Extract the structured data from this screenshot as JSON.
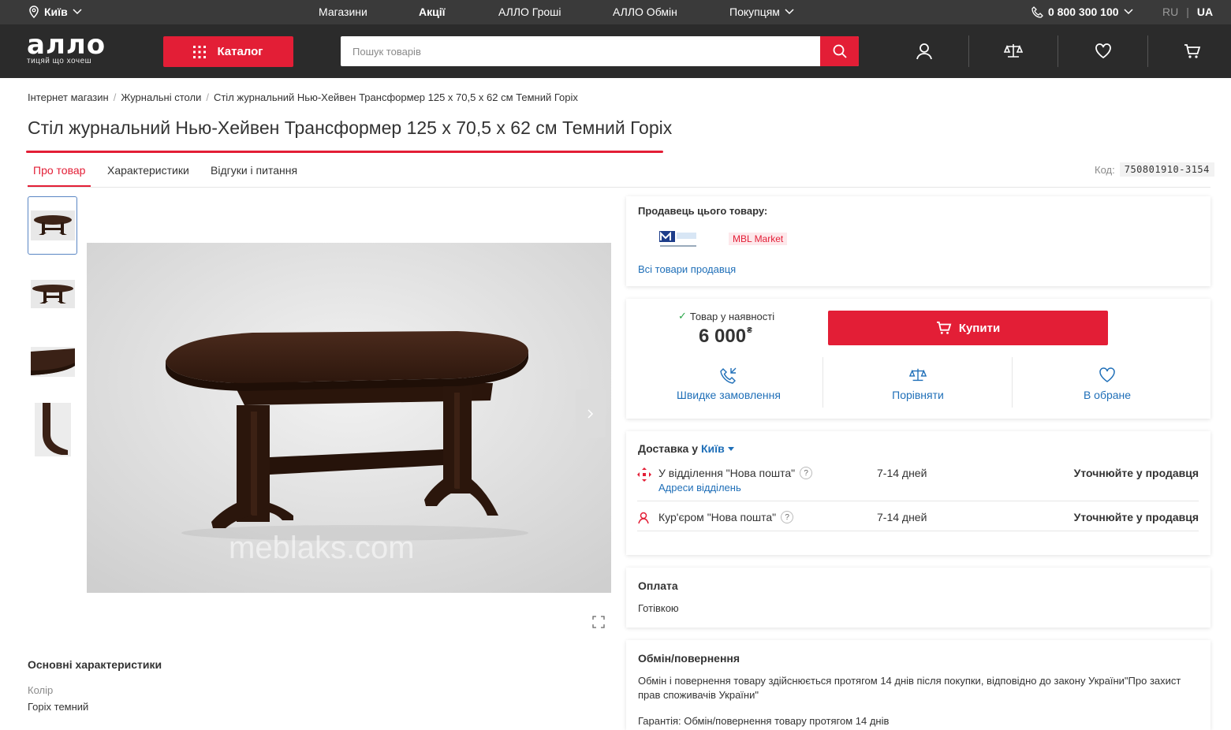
{
  "topbar": {
    "city": "Київ",
    "nav": [
      "Магазини",
      "Акції",
      "АЛЛО Гроші",
      "АЛЛО Обмін",
      "Покупцям"
    ],
    "phone": "0 800 300 100",
    "lang_ru": "RU",
    "lang_sep": "|",
    "lang_ua": "UA"
  },
  "header": {
    "logo": "алло",
    "slogan": "тицяй що хочеш",
    "catalog_label": "Каталог",
    "search_placeholder": "Пошук товарів"
  },
  "breadcrumb": [
    "Інтернет магазин",
    "Журнальні столи",
    "Стіл журнальний Нью-Хейвен Трансформер 125 x 70,5 x 62 см Темний Горіх"
  ],
  "breadcrumb_sep": "/",
  "product": {
    "title": "Стіл журнальний Нью-Хейвен Трансформер 125 x 70,5 x 62 см Темний Горіх",
    "code_label": "Код:",
    "code": "750801910-3154",
    "watermark": "meblaks.com"
  },
  "tabs": [
    "Про товар",
    "Характеристики",
    "Відгуки і питання"
  ],
  "seller": {
    "heading": "Продавець цього товару:",
    "name": "MBL Market",
    "all_link": "Всі товари продавця"
  },
  "buy": {
    "availability": "Товар у наявності",
    "price": "6 000",
    "currency": "₴",
    "buy_label": "Купити",
    "actions": [
      "Швидке замовлення",
      "Порівняти",
      "В обране"
    ]
  },
  "delivery": {
    "heading": "Доставка у",
    "city": "Київ",
    "rows": [
      {
        "name": "У відділення \"Нова пошта\"",
        "sub": "Адреси відділень",
        "days": "7-14 дней",
        "price": "Уточнюйте у продавця"
      },
      {
        "name": "Кур'єром \"Нова пошта\"",
        "days": "7-14 дней",
        "price": "Уточнюйте у продавця"
      }
    ]
  },
  "payment": {
    "heading": "Оплата",
    "text": "Готівкою"
  },
  "returns": {
    "heading": "Обмін/повернення",
    "text": "Обмін і повернення товару здійснюється протягом 14 днів після покупки, відповідно до закону України\"Про захист прав споживачів України\"",
    "guarantee": "Гарантія: Обмін/повернення товару протягом 14 днів"
  },
  "specs": {
    "heading": "Основні характеристики",
    "label": "Колір",
    "value": "Горіх темний"
  },
  "colors": {
    "accent": "#e31e36",
    "link": "#1f6fb8",
    "header_bg": "#2b2b2b",
    "topbar_bg": "#3a3a3a"
  }
}
